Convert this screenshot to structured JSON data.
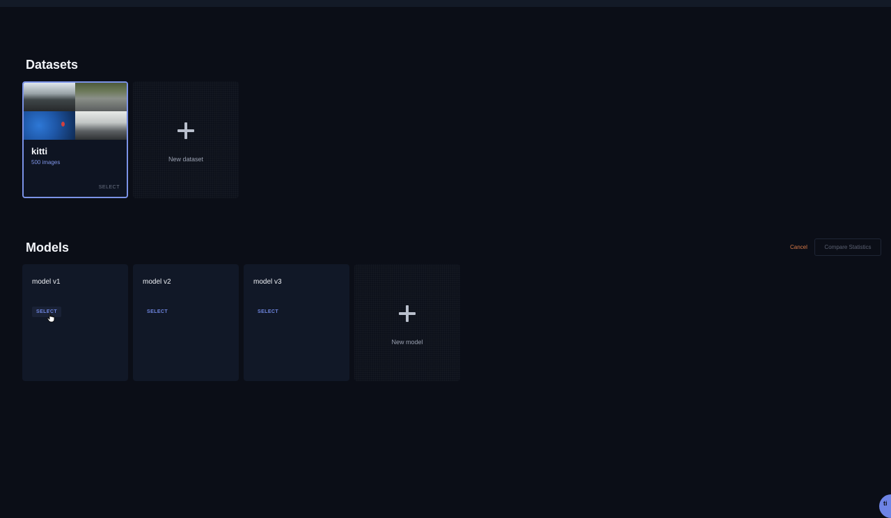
{
  "datasets": {
    "title": "Datasets",
    "items": [
      {
        "name": "kitti",
        "count": "500 images",
        "select_label": "SELECT",
        "selected": true
      }
    ],
    "new_label": "New dataset"
  },
  "models": {
    "title": "Models",
    "cancel_label": "Cancel",
    "compare_label": "Compare Statistics",
    "items": [
      {
        "name": "model v1",
        "select_label": "SELECT"
      },
      {
        "name": "model v2",
        "select_label": "SELECT"
      },
      {
        "name": "model v3",
        "select_label": "SELECT"
      }
    ],
    "new_label": "New model"
  },
  "help": {
    "glyph": "ti"
  },
  "colors": {
    "background": "#0b0e17",
    "card": "#111827",
    "accent": "#7b93e8",
    "cancel": "#d97a48"
  },
  "icons": {
    "add": "plus-icon",
    "cursor": "hand-pointer-icon"
  }
}
